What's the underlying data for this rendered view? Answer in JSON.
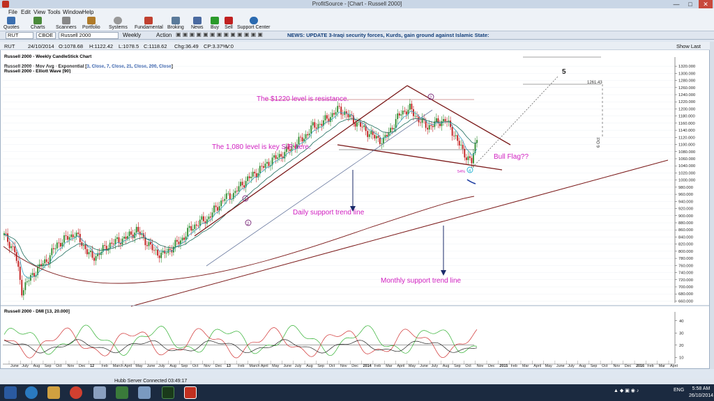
{
  "window": {
    "title": "ProfitSource - [Chart - Russell 2000]",
    "minimize": "—",
    "maximize": "□",
    "close": "✕"
  },
  "menu": [
    "File",
    "Edit",
    "View",
    "Tools",
    "Window",
    "Help"
  ],
  "toolbar": [
    "Quotes",
    "Charts",
    "Scanners",
    "Portfolio",
    "Systems",
    "Fundamental",
    "Broking",
    "News",
    "Buy",
    "Sell",
    "Support Center"
  ],
  "symbolbar": {
    "symbol": "RUT",
    "exchange": "CBOE",
    "name": "Russell 2000",
    "period": "Weekly",
    "action": "Action",
    "news": "NEWS: UPDATE 3-Iraqi security forces, Kurds, gain ground against Islamic State:"
  },
  "infobar": {
    "symbol": "RUT",
    "date": "24/10/2014",
    "open": "O:1078.68",
    "high": "H:1122.42",
    "low": "L:1078.5",
    "close": "C:1118.62",
    "change": "Chg:36.49",
    "pct": "CP:3.37%",
    "vol": "V:0",
    "show_last": "Show Last"
  },
  "legend": {
    "line1": "Russell 2000 - Weekly CandleStick Chart",
    "line2": "Russell 2000 - Mov Avg - Exponential [",
    "line2b": "3, Close, 7, Close, 21, Close, 200, Close",
    "line2c": "]",
    "line3": "Russell 2000 - Elliott Wave [90]",
    "dmi": "Russell 2000 - DMI [13, 20.000]"
  },
  "annotations": {
    "resistance": "The $1220 level is resistance.",
    "key_sr": "The 1,080 level is key S/R here.",
    "bull_flag": "Bull Flag??",
    "daily": "Daily support trend line",
    "monthly": "Monthly support trend line",
    "wave5": "5",
    "wave2a": "2",
    "wave2b": "2",
    "wave2c": "2",
    "wave4": "4",
    "pct": "54%",
    "target_value": "1261.43",
    "target_date": "6 Oct"
  },
  "chart_data": {
    "type": "candlestick",
    "y_ticks": [
      "1320.000",
      "1300.000",
      "1280.000",
      "1260.000",
      "1240.000",
      "1220.000",
      "1200.000",
      "1180.000",
      "1160.000",
      "1140.000",
      "1120.000",
      "1100.000",
      "1080.000",
      "1060.000",
      "1040.000",
      "1020.000",
      "1000.000",
      "980.000",
      "960.000",
      "940.000",
      "920.000",
      "900.000",
      "880.000",
      "860.000",
      "840.000",
      "820.000",
      "800.000",
      "780.000",
      "760.000",
      "740.000",
      "720.000",
      "700.000",
      "680.000",
      "660.000"
    ],
    "ylim": [
      655,
      1330
    ],
    "dmi_ticks": [
      "40",
      "30",
      "20",
      "10"
    ],
    "x_labels": [
      "June",
      "July",
      "Aug",
      "Sep",
      "Oct",
      "Nov",
      "Dec",
      "12",
      "Feb",
      "March",
      "April",
      "May",
      "June",
      "July",
      "Aug",
      "Sep",
      "Oct",
      "Nov",
      "Dec",
      "13",
      "Feb",
      "March",
      "April",
      "May",
      "June",
      "July",
      "Aug",
      "Sep",
      "Oct",
      "Nov",
      "Dec",
      "2014",
      "Feb",
      "Mar",
      "April",
      "May",
      "June",
      "July",
      "Aug",
      "Sep",
      "Oct",
      "Nov",
      "Dec",
      "2015",
      "Feb",
      "Mar",
      "April",
      "May",
      "June",
      "July",
      "Aug",
      "Sep",
      "Oct",
      "Nov",
      "Dec",
      "2016",
      "Feb",
      "Mar",
      "April"
    ],
    "trend_points": [
      [
        0,
        845
      ],
      [
        6,
        800
      ],
      [
        10,
        690
      ],
      [
        14,
        720
      ],
      [
        18,
        745
      ],
      [
        25,
        780
      ],
      [
        30,
        820
      ],
      [
        35,
        835
      ],
      [
        40,
        850
      ],
      [
        45,
        815
      ],
      [
        50,
        780
      ],
      [
        55,
        800
      ],
      [
        60,
        820
      ],
      [
        65,
        830
      ],
      [
        70,
        840
      ],
      [
        75,
        860
      ],
      [
        80,
        830
      ],
      [
        85,
        800
      ],
      [
        90,
        790
      ],
      [
        95,
        810
      ],
      [
        100,
        830
      ],
      [
        105,
        860
      ],
      [
        110,
        880
      ],
      [
        115,
        890
      ],
      [
        120,
        920
      ],
      [
        125,
        950
      ],
      [
        130,
        960
      ],
      [
        135,
        990
      ],
      [
        140,
        1010
      ],
      [
        145,
        1030
      ],
      [
        150,
        1050
      ],
      [
        155,
        1065
      ],
      [
        160,
        1080
      ],
      [
        165,
        1100
      ],
      [
        170,
        1120
      ],
      [
        175,
        1150
      ],
      [
        180,
        1160
      ],
      [
        185,
        1180
      ],
      [
        190,
        1200
      ],
      [
        195,
        1180
      ],
      [
        200,
        1160
      ],
      [
        205,
        1140
      ],
      [
        210,
        1120
      ],
      [
        215,
        1110
      ],
      [
        220,
        1150
      ],
      [
        225,
        1190
      ],
      [
        230,
        1200
      ],
      [
        235,
        1170
      ],
      [
        240,
        1150
      ],
      [
        245,
        1160
      ],
      [
        250,
        1170
      ],
      [
        255,
        1130
      ],
      [
        260,
        1080
      ],
      [
        265,
        1050
      ],
      [
        268,
        1118
      ]
    ]
  },
  "status": {
    "server": "Hubb Server Connected 03:49:17"
  },
  "taskbar": {
    "lang": "ENG",
    "time": "5:58 AM",
    "date": "26/10/2014"
  },
  "colors": {
    "up": "#2a8a2a",
    "down": "#c01818",
    "trend": "#7b1a1a",
    "annotation": "#d020c0",
    "arrow": "#1a2a6a"
  }
}
